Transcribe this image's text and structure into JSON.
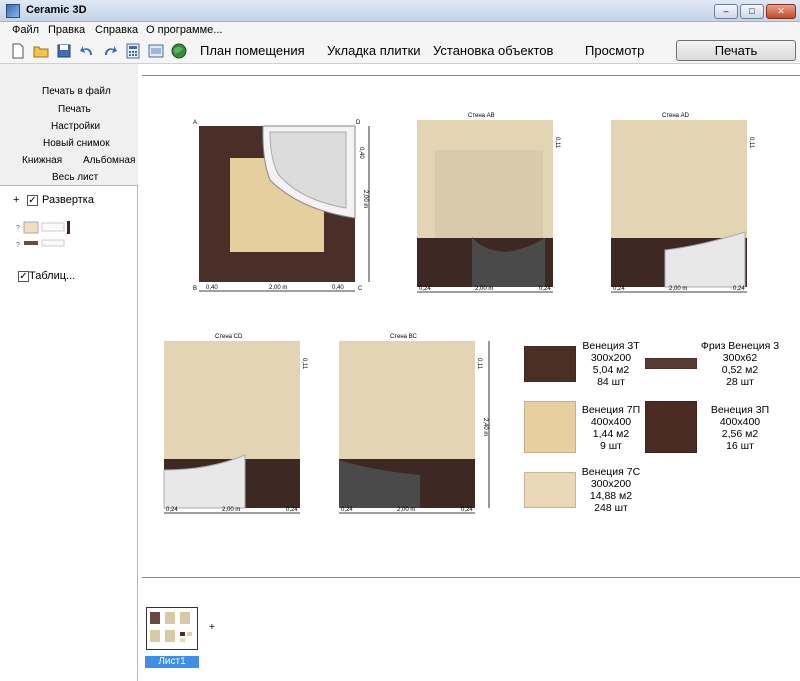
{
  "window": {
    "title": "Ceramic 3D",
    "buttons": {
      "minimize": "–",
      "maximize": "□",
      "close": "✕"
    }
  },
  "menu": {
    "items": [
      "Файл",
      "Правка",
      "Справка",
      "О программе..."
    ]
  },
  "toolbar": {
    "icons": [
      "new-file-icon",
      "open-folder-icon",
      "save-icon",
      "undo-icon",
      "redo-icon",
      "calculator-icon",
      "report-icon",
      "globe-icon"
    ],
    "modes": [
      "План помещения",
      "Укладка плитки",
      "Установка объектов",
      "Просмотр"
    ],
    "print_label": "Печать"
  },
  "left_panel": {
    "actions": [
      "Печать в файл",
      "Печать",
      "Настройки",
      "Новый снимок",
      "Книжная",
      "Альбомная",
      "Весь лист"
    ],
    "tree": {
      "plus": "+",
      "root_label": "Развертка",
      "table_label": "Таблиц...",
      "checked": "✓"
    }
  },
  "sheet": {
    "views": [
      {
        "title": "",
        "corners": [
          "A",
          "D",
          "B",
          "C"
        ],
        "dim_bottom": [
          "0,40",
          "2,00 m",
          "0,40"
        ],
        "dim_top_right": "0,40",
        "dim_right": "2,00 m"
      },
      {
        "title": "Стена АВ",
        "dim_bottom": [
          "0,24",
          "2,00 m",
          "0,24"
        ],
        "dim_top_right": "0,11"
      },
      {
        "title": "Стена AD",
        "dim_bottom": [
          "0,24",
          "2,00 m",
          "0,24"
        ],
        "dim_top_right": "0,11"
      },
      {
        "title": "Стена CD",
        "dim_bottom": [
          "0,24",
          "2,00 m",
          "0,24"
        ],
        "dim_top_right": "0,11"
      },
      {
        "title": "Стена ВС",
        "dim_bottom": [
          "0,24",
          "2,00 m",
          "0,24"
        ],
        "dim_top_right": "0,11",
        "dim_right": "2,40 m"
      }
    ],
    "tiles": [
      {
        "name": "Венеция 3Т",
        "size": "300x200",
        "area": "5,04 м2",
        "count": "84 шт",
        "color": "#4a2f27"
      },
      {
        "name": "Фриз Венеция 3",
        "size": "300x62",
        "area": "0,52 м2",
        "count": "28 шт",
        "color": "#5a3a31"
      },
      {
        "name": "Венеция 7П",
        "size": "400x400",
        "area": "1,44 м2",
        "count": "9 шт",
        "color": "#e8cf9f"
      },
      {
        "name": "Венеция 3П",
        "size": "400x400",
        "area": "2,56 м2",
        "count": "16 шт",
        "color": "#4b2b22"
      },
      {
        "name": "Венеция 7С",
        "size": "300x200",
        "area": "14,88 м2",
        "count": "248 шт",
        "color": "#ead8b6"
      }
    ]
  },
  "sheets_bar": {
    "tab_label": "Лист1",
    "add": "+"
  },
  "colors": {
    "wall_light": "#e5d8b8",
    "wall_dark": "#3f2823",
    "tub": "#d9d9d9",
    "selection": "#3c8ee8"
  }
}
